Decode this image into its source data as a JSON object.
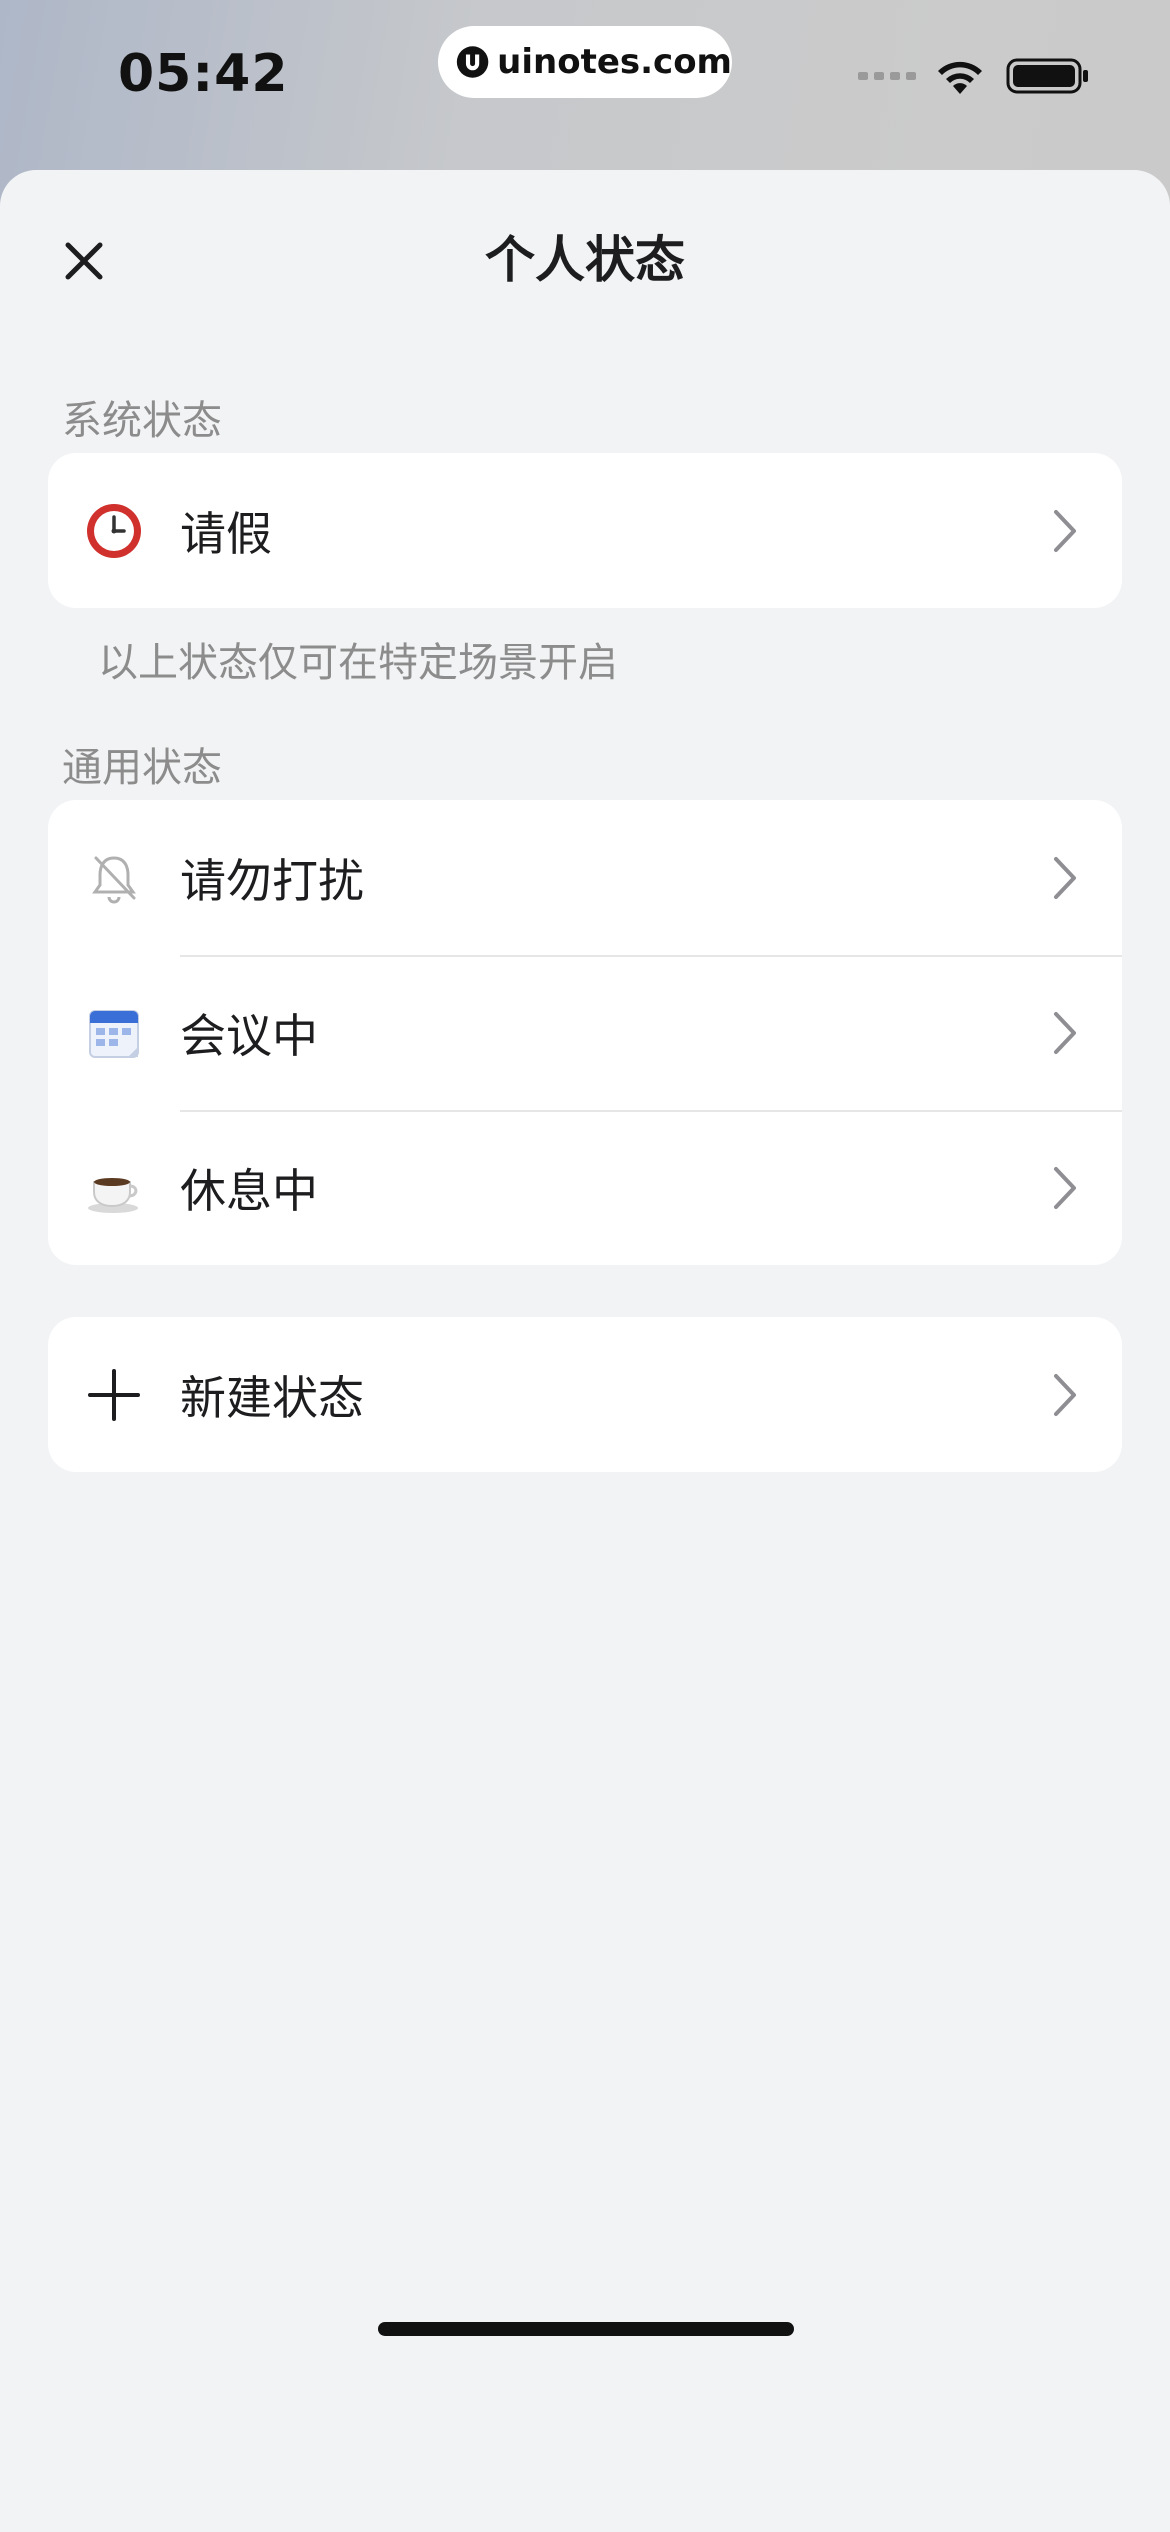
{
  "status_bar": {
    "time": "05:42",
    "watermark": "uinotes.com",
    "icons": [
      "signal-icon",
      "wifi-icon",
      "battery-icon"
    ]
  },
  "header": {
    "title": "个人状态",
    "close_icon": "close-icon"
  },
  "system_section": {
    "label": "系统状态",
    "items": [
      {
        "label": "请假",
        "icon": "clock-icon"
      }
    ],
    "note": "以上状态仅可在特定场景开启"
  },
  "general_section": {
    "label": "通用状态",
    "items": [
      {
        "label": "请勿打扰",
        "icon": "bell-off-icon"
      },
      {
        "label": "会议中",
        "icon": "calendar-icon"
      },
      {
        "label": "休息中",
        "icon": "coffee-icon"
      }
    ]
  },
  "create": {
    "label": "新建状态",
    "icon": "plus-icon"
  },
  "colors": {
    "sheet_bg": "#f2f3f5",
    "card_bg": "#ffffff",
    "text_primary": "#1d1d1f",
    "text_secondary": "#8c8c8c",
    "clock_red": "#d0312d",
    "calendar_blue": "#3a6fd8"
  }
}
